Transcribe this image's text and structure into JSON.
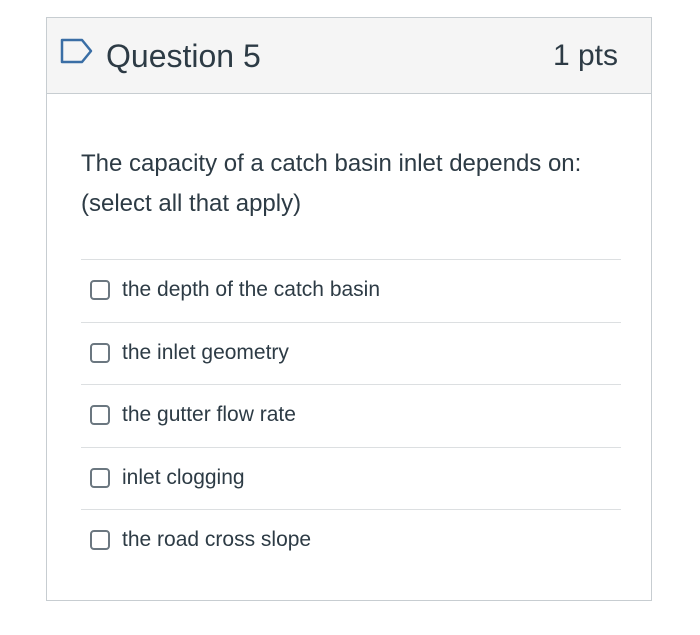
{
  "question": {
    "title": "Question 5",
    "points": "1 pts",
    "text_line1": "The capacity of a catch basin inlet depends on:",
    "text_line2": "(select all that apply)",
    "flag_icon": "flag-outline-icon",
    "accent_color": "#3a6ea5"
  },
  "answers": [
    {
      "label": "the depth of the catch basin",
      "checked": false
    },
    {
      "label": "the inlet geometry",
      "checked": false
    },
    {
      "label": "the gutter flow rate",
      "checked": false
    },
    {
      "label": "inlet clogging",
      "checked": false
    },
    {
      "label": "the road cross slope",
      "checked": false
    }
  ]
}
